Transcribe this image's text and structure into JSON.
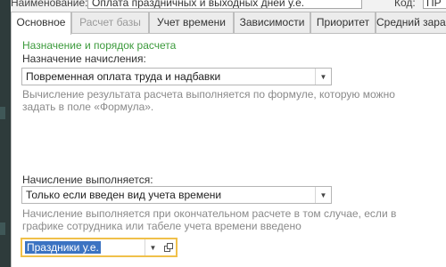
{
  "header": {
    "name_label": "Наименование:",
    "name_value": "Оплата праздничных и выходных дней у.е.",
    "code_label": "Код:",
    "code_value": "ПР"
  },
  "tabs": [
    {
      "label": "Основное",
      "state": "active"
    },
    {
      "label": "Расчет базы",
      "state": "disabled"
    },
    {
      "label": "Учет времени",
      "state": "normal"
    },
    {
      "label": "Зависимости",
      "state": "normal"
    },
    {
      "label": "Приоритет",
      "state": "normal"
    },
    {
      "label": "Средний зарабо",
      "state": "normal"
    }
  ],
  "main": {
    "section_title": "Назначение и порядок расчета",
    "purpose_label": "Назначение начисления:",
    "purpose_value": "Повременная оплата труда и надбавки",
    "purpose_hint": "Вычисление результата расчета выполняется по формуле, которую можно задать в поле «Формула».",
    "accrual_label": "Начисление выполняется:",
    "accrual_value": "Только если введен вид учета времени",
    "accrual_hint": "Начисление выполняется при окончательном расчете в том случае, если в графике сотрудника или табеле учета времени введено",
    "time_type_value": "Праздники у.е."
  },
  "colors": {
    "section_title": "#3c9a3c",
    "hint_text": "#8a8a8a",
    "focus_border": "#f0c04a",
    "selection": "#3b73c2"
  },
  "icons": {
    "dropdown": "chevron-down-icon",
    "open": "open-form-icon"
  }
}
